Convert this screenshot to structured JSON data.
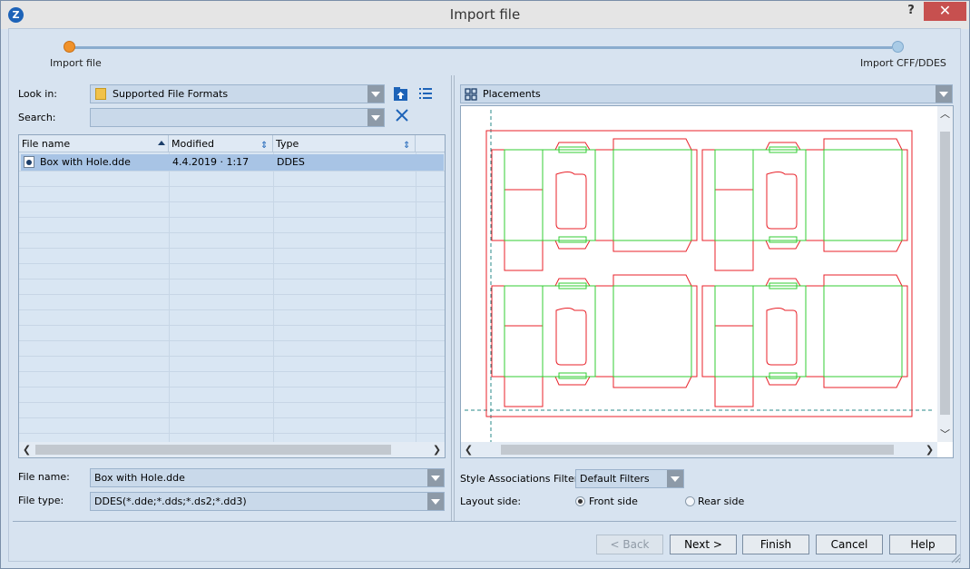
{
  "window": {
    "title": "Import file",
    "help_glyph": "?",
    "close_glyph": "✕",
    "app_glyph": "Z"
  },
  "steps": [
    {
      "label": "Import file",
      "state": "current",
      "color": "#f0922b"
    },
    {
      "label": "Import CFF/DDES",
      "state": "pending",
      "color": "#a9cbe6"
    }
  ],
  "left": {
    "look_in_label": "Look in:",
    "look_in_value": "Supported File Formats",
    "search_label": "Search:",
    "search_value": "",
    "columns": [
      "File name",
      "Modified",
      "Type"
    ],
    "files": [
      {
        "name": "Box with Hole.dde",
        "modified": "4.4.2019 · 1:17",
        "type": "DDES"
      }
    ],
    "file_name_label": "File name:",
    "file_name_value": "Box with Hole.dde",
    "file_type_label": "File type:",
    "file_type_value": "DDES(*.dde;*.dds;*.ds2;*.dd3)"
  },
  "right": {
    "placements_label": "Placements",
    "style_filter_label": "Style Associations Filter",
    "style_filter_value": "Default Filters",
    "layout_side_label": "Layout side:",
    "front_side_label": "Front side",
    "rear_side_label": "Rear side",
    "selected_side": "front"
  },
  "buttons": {
    "back": "< Back",
    "next": "Next >",
    "finish": "Finish",
    "cancel": "Cancel",
    "help": "Help"
  },
  "colors": {
    "cut_line": "#e8222a",
    "crease_line": "#33cc33",
    "accent": "#1d63b8"
  }
}
